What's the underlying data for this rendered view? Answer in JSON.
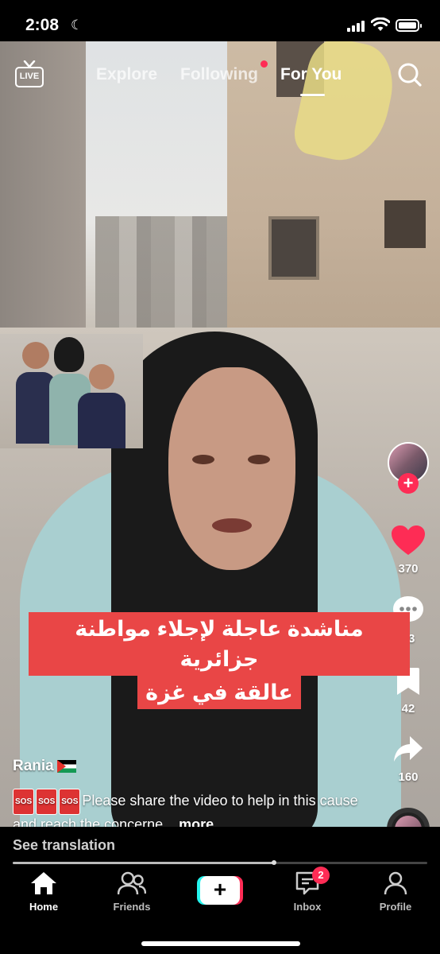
{
  "status_bar": {
    "time": "2:08",
    "icons": [
      "moon-icon",
      "cellular-signal-icon",
      "wifi-icon",
      "battery-icon"
    ]
  },
  "top_nav": {
    "live_label": "LIVE",
    "tabs": [
      {
        "label": "Explore",
        "active": false
      },
      {
        "label": "Following",
        "active": false,
        "has_dot": true
      },
      {
        "label": "For You",
        "active": true
      }
    ],
    "icons": [
      "live-icon",
      "search-icon"
    ]
  },
  "video": {
    "caption_line1": "مناشدة عاجلة لإجلاء مواطنة جزائرية",
    "caption_line2": "عالقة في غزة",
    "author": "Rania",
    "description_badges": [
      "SOS",
      "SOS",
      "SOS"
    ],
    "description": "Please share the video to help in this cause and reach the concerne...",
    "more_label": "more",
    "see_translation": "See translation",
    "progress": 0.63
  },
  "actions": {
    "likes": "370",
    "comments": "63",
    "bookmarks": "42",
    "shares": "160",
    "follow_plus": "+"
  },
  "tab_bar": {
    "home": "Home",
    "friends": "Friends",
    "create": "+",
    "inbox": "Inbox",
    "inbox_badge": "2",
    "profile": "Profile"
  },
  "colors": {
    "accent": "#fe2c55",
    "cyan": "#25f4ee",
    "caption_bg": "#e94646",
    "like_heart": "#fe2c55"
  }
}
